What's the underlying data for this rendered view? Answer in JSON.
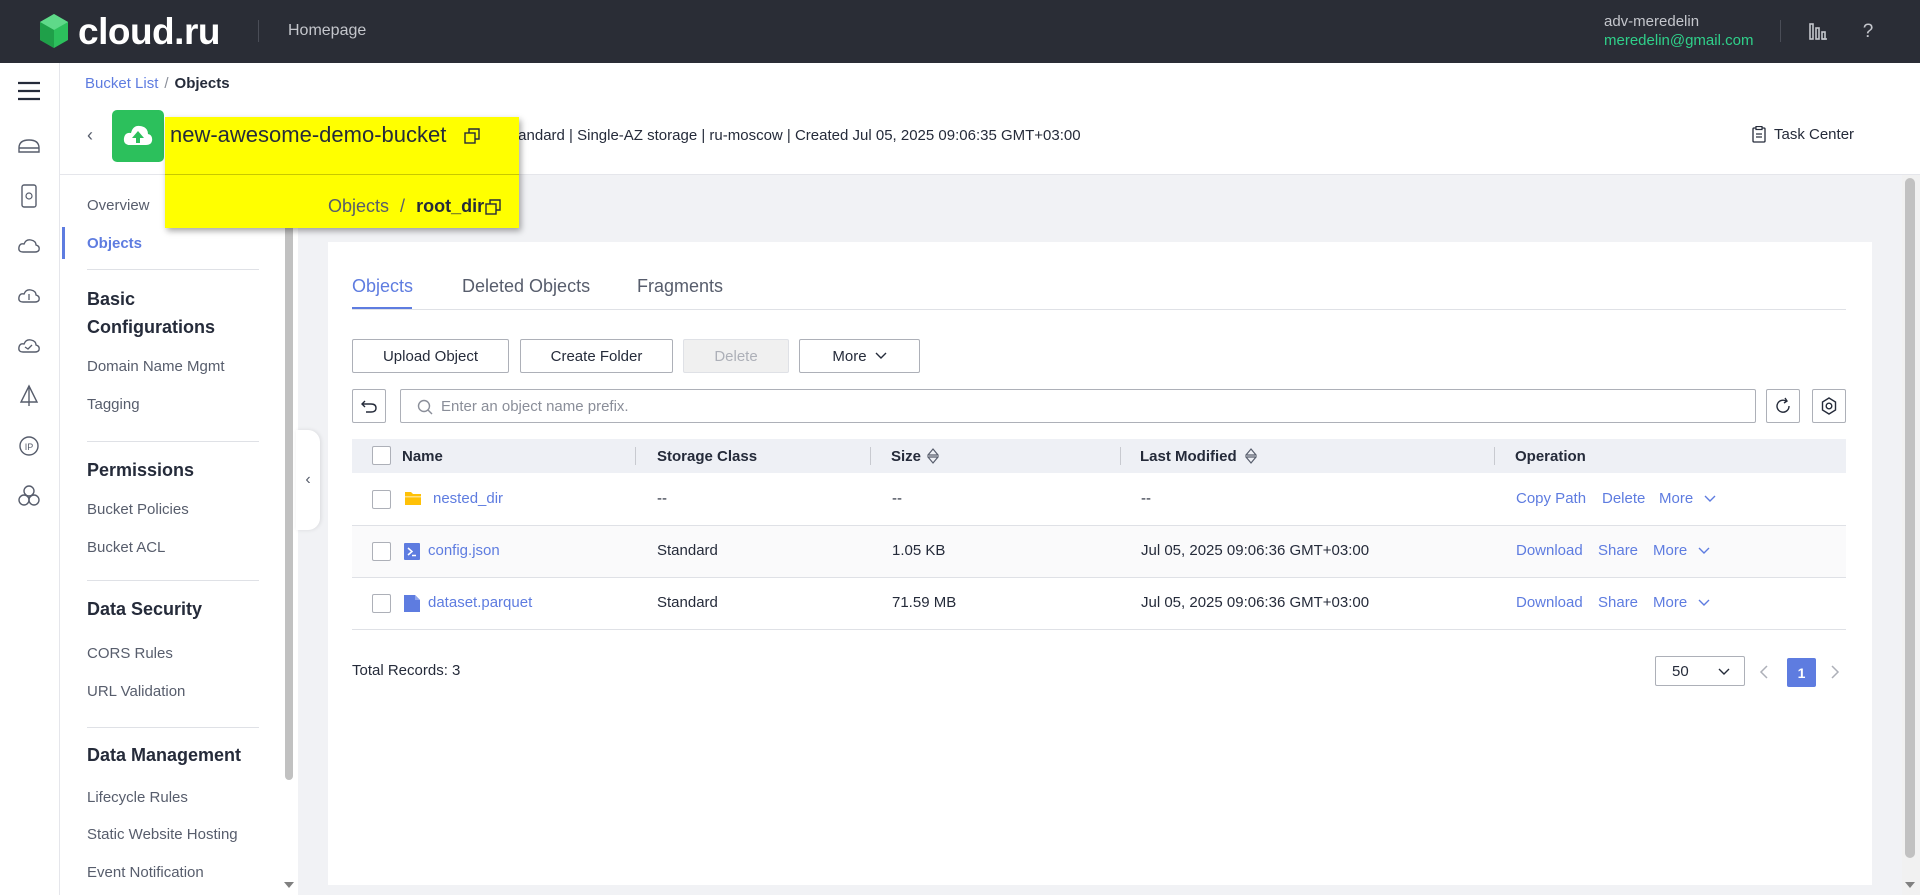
{
  "topbar": {
    "brand": "cloud.ru",
    "homepage": "Homepage",
    "user_name": "adv-meredelin",
    "user_email": "meredelin@gmail.com",
    "brand_color": "#2cc05c"
  },
  "breadcrumb": {
    "parent": "Bucket List",
    "separator": "/",
    "current": "Objects"
  },
  "bucket": {
    "name": "new-awesome-demo-bucket",
    "meta": "Standard | Single-AZ storage | ru-moscow | Created  Jul 05, 2025 09:06:35 GMT+03:00",
    "path_parent": "Objects",
    "path_separator": "/",
    "path_current": "root_dir"
  },
  "task_center": "Task Center",
  "sidebar": {
    "overview": "Overview",
    "objects": "Objects",
    "basic_title": "Basic Configurations",
    "domain": "Domain Name Mgmt",
    "tagging": "Tagging",
    "permissions_title": "Permissions",
    "bucket_policies": "Bucket Policies",
    "bucket_acl": "Bucket ACL",
    "security_title": "Data Security",
    "cors": "CORS Rules",
    "url_validation": "URL Validation",
    "management_title": "Data Management",
    "lifecycle": "Lifecycle Rules",
    "static_hosting": "Static Website Hosting",
    "event_notification": "Event Notification"
  },
  "tabs": [
    "Objects",
    "Deleted Objects",
    "Fragments"
  ],
  "toolbar": {
    "upload": "Upload Object",
    "create_folder": "Create Folder",
    "delete": "Delete",
    "more": "More"
  },
  "search": {
    "placeholder": "Enter an object name prefix."
  },
  "table": {
    "headers": {
      "name": "Name",
      "storage": "Storage Class",
      "size": "Size",
      "modified": "Last Modified",
      "operation": "Operation"
    },
    "rows": [
      {
        "name": "nested_dir",
        "storage": "--",
        "size": "--",
        "modified": "--",
        "op1": "Copy Path",
        "op2": "Delete",
        "op3": "More"
      },
      {
        "name": "config.json",
        "storage": "Standard",
        "size": "1.05 KB",
        "modified": "Jul 05, 2025 09:06:36 GMT+03:00",
        "op1": "Download",
        "op2": "Share",
        "op3": "More"
      },
      {
        "name": "dataset.parquet",
        "storage": "Standard",
        "size": "71.59 MB",
        "modified": "Jul 05, 2025 09:06:36 GMT+03:00",
        "op1": "Download",
        "op2": "Share",
        "op3": "More"
      }
    ]
  },
  "footer": {
    "total": "Total Records: 3",
    "page_size": "50",
    "page": "1"
  },
  "colors": {
    "accent": "#5e7ce0",
    "highlight": "#ffff00",
    "folder": "#ffc107"
  }
}
